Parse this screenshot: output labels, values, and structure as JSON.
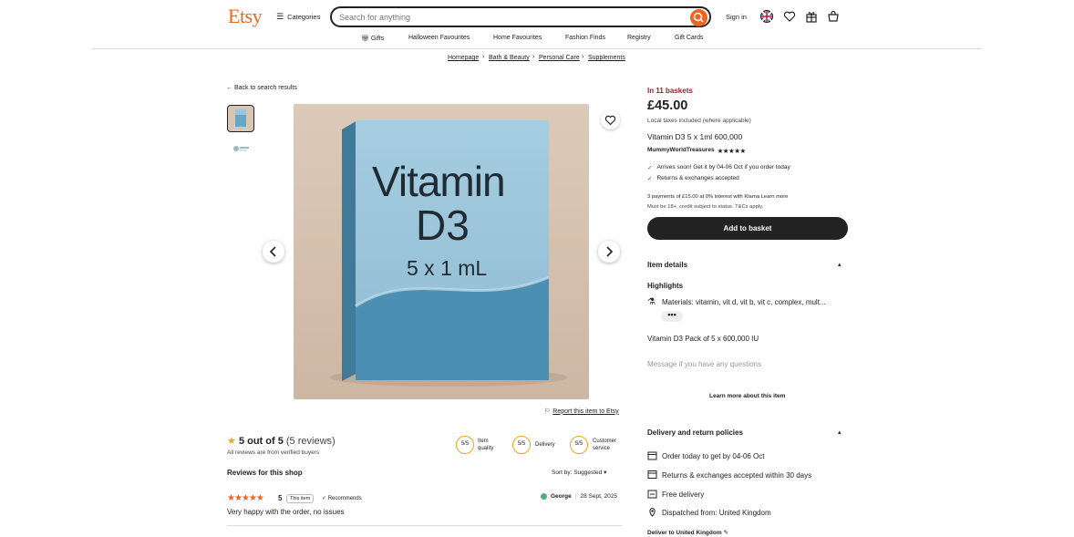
{
  "header": {
    "logo": "Etsy",
    "categories_label": "Categories",
    "search_placeholder": "Search for anything",
    "signin_label": "Sign in"
  },
  "nav": {
    "items": [
      "Gifts",
      "Halloween Favourites",
      "Home Favourites",
      "Fashion Finds",
      "Registry",
      "Gift Cards"
    ]
  },
  "breadcrumb": [
    "Homepage",
    "Bath & Beauty",
    "Personal Care",
    "Supplements"
  ],
  "back_label": "Back to search results",
  "product_image": {
    "line1": "Vitamin",
    "line2": "D3",
    "line3": "5 x 1 mL"
  },
  "report_label": "Report this item to Etsy",
  "listing": {
    "in_baskets": "In 11 baskets",
    "price": "£45.00",
    "tax_note": "Local taxes included (where applicable)",
    "title": "Vitamin D3 5 x 1ml 600,000",
    "shop_name": "MummyWorldTreasures",
    "shop_stars": "★★★★★",
    "arrives": "Arrives soon! Get it by 04-06 Oct if you order today",
    "returns": "Returns & exchanges accepted",
    "klarna_line": "3 payments of £15.00 at 0% interest with Klarna Learn more",
    "klarna_note": "Must be 18+, credit subject to status. T&Cs apply.",
    "add_to_basket": "Add to basket",
    "item_details": "Item details",
    "highlights": "Highlights",
    "materials": "Materials: vitamin, vit d, vit b, vit c, complex, mult...",
    "more_dots": "•••",
    "description": "Vitamin D3 Pack of 5 x 600,000 IU",
    "message_prompt": "Message if you have any questions",
    "learn_more": "Learn more about this item",
    "delivery_title": "Delivery and return policies",
    "order_today": "Order today to get by 04-06 Oct",
    "returns_window": "Returns & exchanges accepted within 30 days",
    "free_delivery": "Free delivery",
    "dispatched": "Dispatched from: United Kingdom",
    "deliver_to": "Deliver to United Kingdom"
  },
  "reviews": {
    "score": "5 out of 5",
    "count": "(5 reviews)",
    "verified": "All reviews are from verified buyers",
    "ratings": [
      {
        "score": "5/5",
        "label": "Item quality"
      },
      {
        "score": "5/5",
        "label": "Delivery"
      },
      {
        "score": "5/5",
        "label": "Customer service"
      }
    ],
    "shop_heading": "Reviews for this shop",
    "sort": "Sort by: Suggested",
    "items": [
      {
        "stars": "★★★★★",
        "rating": "5",
        "badge": "This item",
        "recommends": "✓ Recommends",
        "text": "Very happy with the order, no issues",
        "reviewer": "George",
        "date": "28 Sept, 2025"
      }
    ]
  },
  "colors": {
    "brand": "#f1641e",
    "basket_button": "#222222",
    "in_baskets": "#a61a2e",
    "box_blue": "#6aa7c6"
  }
}
